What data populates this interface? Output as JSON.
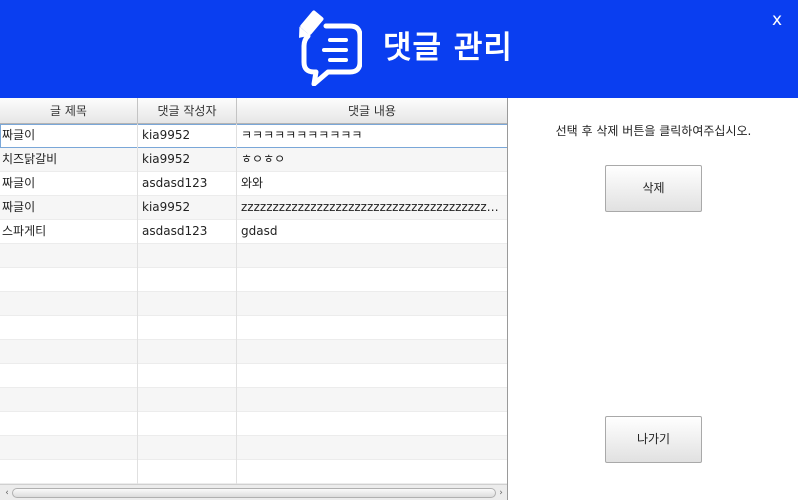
{
  "header": {
    "title": "댓글 관리",
    "close_label": "x",
    "background_color": "#0a3ef0",
    "logo_icon": "comment-edit-icon"
  },
  "table": {
    "columns": [
      "글 제목",
      "댓글 작성자",
      "댓글 내용"
    ],
    "rows": [
      {
        "title": "짜글이",
        "author": "kia9952",
        "content": "ㅋㅋㅋㅋㅋㅋㅋㅋㅋㅋㅋ"
      },
      {
        "title": "치즈닭갈비",
        "author": "kia9952",
        "content": "ㅎㅇㅎㅇ"
      },
      {
        "title": "짜글이",
        "author": "asdasd123",
        "content": "와와"
      },
      {
        "title": "짜글이",
        "author": "kia9952",
        "content": "zzzzzzzzzzzzzzzzzzzzzzzzzzzzzzzzzzzzzzzzzz..."
      },
      {
        "title": "스파게티",
        "author": "asdasd123",
        "content": "gdasd"
      }
    ],
    "selected_row": 0
  },
  "side": {
    "instruction": "선택 후 삭제 버튼을 클릭하여주십시오.",
    "delete_label": "삭제",
    "exit_label": "나가기"
  }
}
